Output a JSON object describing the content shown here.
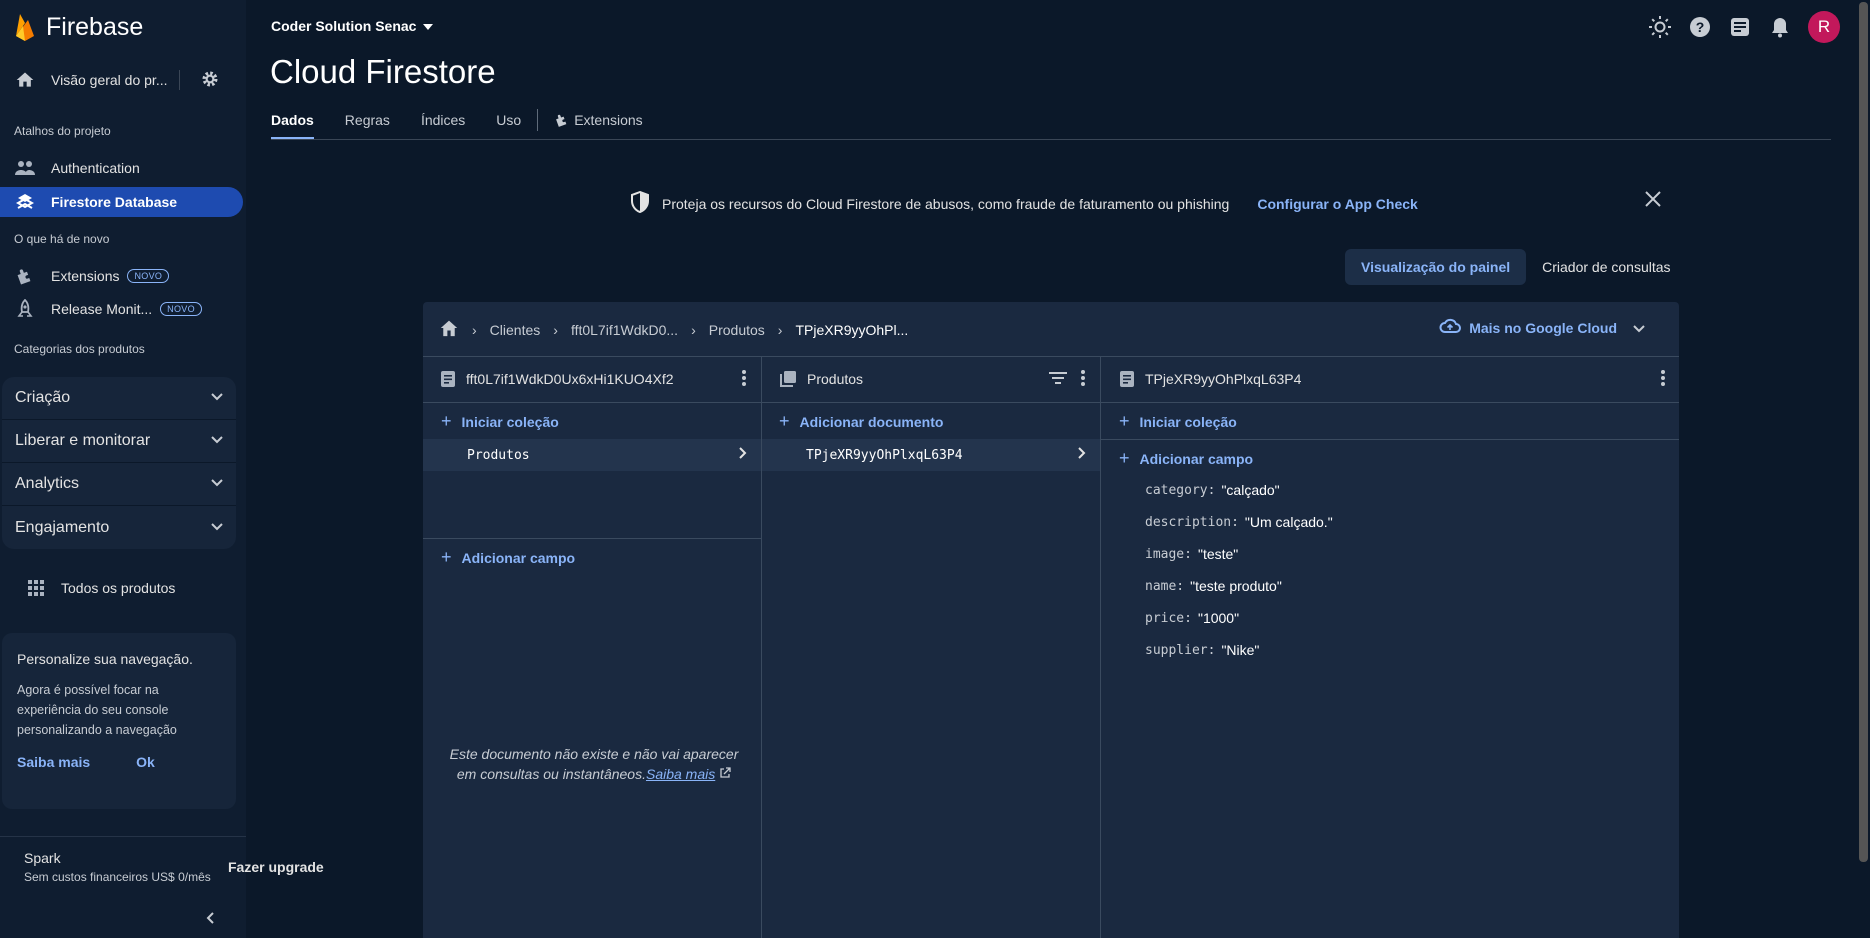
{
  "brand": {
    "name": "Firebase"
  },
  "sidebar": {
    "overview_label": "Visão geral do pr...",
    "shortcuts_label": "Atalhos do projeto",
    "shortcuts": [
      {
        "label": "Authentication",
        "icon": "people-icon"
      },
      {
        "label": "Firestore Database",
        "icon": "firestore-icon",
        "active": true
      }
    ],
    "new_label": "O que há de novo",
    "new_items": [
      {
        "label": "Extensions",
        "badge": "NOVO"
      },
      {
        "label": "Release Monit...",
        "badge": "NOVO"
      }
    ],
    "categories_label": "Categorias dos produtos",
    "groups": [
      {
        "label": "Criação"
      },
      {
        "label": "Liberar e monitorar"
      },
      {
        "label": "Analytics"
      },
      {
        "label": "Engajamento"
      }
    ],
    "all_products_label": "Todos os produtos",
    "card": {
      "title": "Personalize sua navegação.",
      "text": "Agora é possível focar na experiência do seu console personalizando a navegação",
      "learn_more": "Saiba mais",
      "ok": "Ok"
    },
    "plan_name": "Spark",
    "plan_desc": "Sem custos financeiros US$ 0/mês",
    "upgrade_label": "Fazer upgrade"
  },
  "header": {
    "project": "Coder Solution Senac",
    "title": "Cloud Firestore",
    "avatar_letter": "R",
    "tabs": [
      "Dados",
      "Regras",
      "Índices",
      "Uso",
      "Extensions"
    ]
  },
  "banner": {
    "text": "Proteja os recursos do Cloud Firestore de abusos, como fraude de faturamento ou phishing",
    "link": "Configurar o App Check"
  },
  "view_buttons": {
    "panel": "Visualização do painel",
    "query": "Criador de consultas"
  },
  "breadcrumbs": [
    "Clientes",
    "fft0L7if1WdkD0...",
    "Produtos",
    "TPjeXR9yyOhPl..."
  ],
  "more_google_cloud": "Mais no Google Cloud",
  "columns": {
    "doc1": {
      "title": "fft0L7if1WdkD0Ux6xHi1KUO4Xf2",
      "start_collection": "Iniciar coleção",
      "item": "Produtos",
      "add_field": "Adicionar campo",
      "note": "Este documento não existe e não vai aparecer em consultas ou instantâneos.",
      "note_link": "Saiba mais"
    },
    "collection": {
      "title": "Produtos",
      "add_document": "Adicionar documento",
      "item": "TPjeXR9yyOhPlxqL63P4"
    },
    "doc2": {
      "title": "TPjeXR9yyOhPlxqL63P4",
      "start_collection": "Iniciar coleção",
      "add_field": "Adicionar campo",
      "fields": [
        {
          "key": "category:",
          "value": "\"calçado\""
        },
        {
          "key": "description:",
          "value": "\"Um calçado.\""
        },
        {
          "key": "image:",
          "value": "\"teste\""
        },
        {
          "key": "name:",
          "value": "\"teste produto\""
        },
        {
          "key": "price:",
          "value": "\"1000\""
        },
        {
          "key": "supplier:",
          "value": "\"Nike\""
        }
      ]
    }
  }
}
